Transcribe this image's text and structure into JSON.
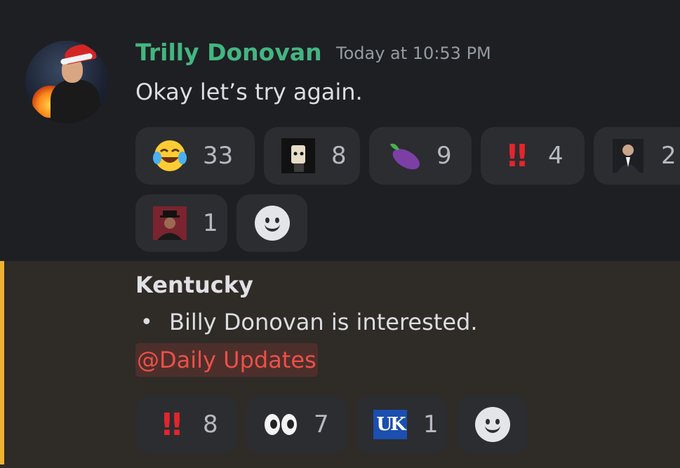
{
  "message1": {
    "username": "Trilly Donovan",
    "timestamp": "Today at 10:53 PM",
    "content": "Okay let’s try again.",
    "reactions": [
      {
        "icon": "tears-of-joy-emoji",
        "count": "33"
      },
      {
        "icon": "masked-figure-custom-emoji",
        "count": "8"
      },
      {
        "icon": "eggplant-emoji",
        "count": "9"
      },
      {
        "icon": "double-exclamation-emoji",
        "count": "4"
      },
      {
        "icon": "man-in-suit-custom-emoji",
        "count": "2"
      },
      {
        "icon": "coach-custom-emoji",
        "count": "1"
      }
    ],
    "add_reaction_icon": "add-reaction-smiley-icon"
  },
  "message2": {
    "title": "Kentucky",
    "bullet": "•",
    "text": "Billy Donovan is interested.",
    "mention": "@Daily Updates",
    "reactions": [
      {
        "icon": "double-exclamation-emoji",
        "count": "8"
      },
      {
        "icon": "eyes-emoji",
        "count": "7"
      },
      {
        "icon": "uk-logo-custom-emoji",
        "count": "1"
      }
    ],
    "accent_color": "#f0b232"
  },
  "colors": {
    "username": "#43b581",
    "mention": "#ee4f49",
    "background": "#1e1f22",
    "highlight_background": "#2f2b27"
  }
}
